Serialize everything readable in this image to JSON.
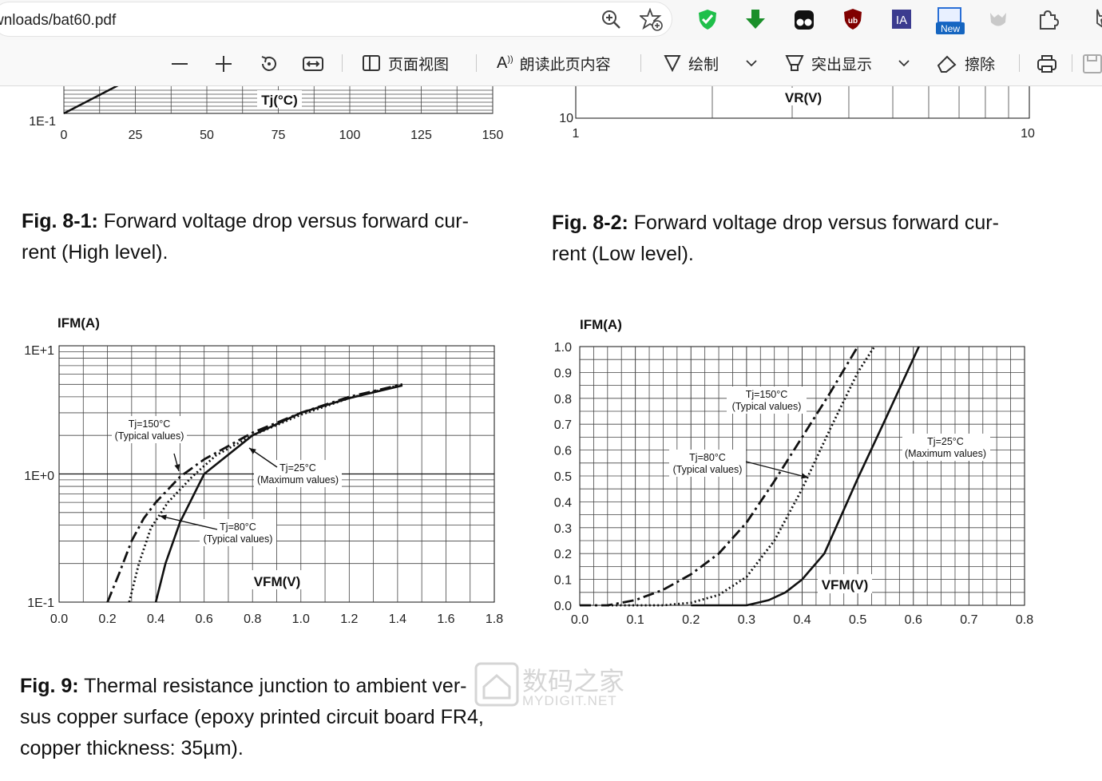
{
  "browser": {
    "url": "wnloads/bat60.pdf",
    "badge_new": "New",
    "ia_label": "IA",
    "ub_label": "ub"
  },
  "pdf_toolbar": {
    "page_view": "页面视图",
    "read_aloud": "朗读此页内容",
    "draw": "绘制",
    "highlight": "突出显示",
    "erase": "擦除",
    "read_prefix": "A"
  },
  "captions": {
    "fig81": {
      "label": "Fig. 8-1:",
      "line1": " Forward voltage drop versus forward cur-",
      "line2": "rent (High level)."
    },
    "fig82": {
      "label": "Fig. 8-2:",
      "line1": " Forward voltage drop versus forward cur-",
      "line2": "rent (Low level)."
    },
    "fig9": {
      "label": "Fig. 9:",
      "line1": " Thermal resistance junction to ambient ver-",
      "line2": "sus copper surface (epoxy printed circuit board FR4,",
      "line3": "copper thickness: 35µm)."
    }
  },
  "watermark": {
    "title": "数码之家",
    "subtitle": "MYDIGIT.NET"
  },
  "chart_data": [
    {
      "type": "line",
      "name_on_chart": "top-left partial",
      "xlabel": "Tj(°C)",
      "x_ticks": [
        "0",
        "25",
        "50",
        "75",
        "100",
        "125",
        "150"
      ],
      "y_ticks": [
        "1E-1"
      ],
      "series": [
        {
          "x": [
            0,
            20
          ],
          "y_frac_visible": [
            0.0,
            1.0
          ]
        }
      ]
    },
    {
      "type": "line",
      "name_on_chart": "top-right partial",
      "xlabel": "VR(V)",
      "x_ticks": [
        "1",
        "10"
      ],
      "y_ticks": [
        "10"
      ],
      "xscale": "log"
    },
    {
      "type": "line",
      "title": "",
      "ylabel": "IFM(A)",
      "xlabel": "VFM(V)",
      "yscale": "log",
      "xlim": [
        0,
        1.8
      ],
      "ylim": [
        0.1,
        10
      ],
      "x_ticks": [
        "0.0",
        "0.2",
        "0.4",
        "0.6",
        "0.8",
        "1.0",
        "1.2",
        "1.4",
        "1.6",
        "1.8"
      ],
      "y_ticks": [
        "1E-1",
        "1E+0",
        "1E+1"
      ],
      "annotations": [
        {
          "l1": "Tj=150°C",
          "l2": "(Typical values)"
        },
        {
          "l1": "Tj=25°C",
          "l2": "(Maximum values)"
        },
        {
          "l1": "Tj=80°C",
          "l2": "(Typical values)"
        }
      ],
      "series": [
        {
          "style": "dashdot",
          "x": [
            0.2,
            0.25,
            0.3,
            0.35,
            0.4,
            0.5,
            0.6,
            0.8,
            1.0,
            1.2,
            1.42
          ],
          "y": [
            0.1,
            0.17,
            0.3,
            0.45,
            0.6,
            0.95,
            1.3,
            2.1,
            3.0,
            4.0,
            5.0
          ]
        },
        {
          "style": "dotted",
          "x": [
            0.29,
            0.33,
            0.38,
            0.45,
            0.55,
            0.65,
            0.8,
            1.0,
            1.2,
            1.42
          ],
          "y": [
            0.1,
            0.2,
            0.38,
            0.6,
            0.95,
            1.4,
            2.0,
            2.9,
            3.9,
            5.0
          ]
        },
        {
          "style": "solid",
          "x": [
            0.4,
            0.44,
            0.5,
            0.6,
            0.8,
            1.0,
            1.2,
            1.42
          ],
          "y": [
            0.1,
            0.2,
            0.42,
            1.0,
            2.0,
            3.0,
            3.9,
            4.9
          ]
        }
      ]
    },
    {
      "type": "line",
      "title": "",
      "ylabel": "IFM(A)",
      "xlabel": "VFM(V)",
      "xlim": [
        0,
        0.8
      ],
      "ylim": [
        0,
        1.0
      ],
      "x_ticks": [
        "0.0",
        "0.1",
        "0.2",
        "0.3",
        "0.4",
        "0.5",
        "0.6",
        "0.7",
        "0.8"
      ],
      "y_ticks": [
        "0.0",
        "0.1",
        "0.2",
        "0.3",
        "0.4",
        "0.5",
        "0.6",
        "0.7",
        "0.8",
        "0.9",
        "1.0"
      ],
      "annotations": [
        {
          "l1": "Tj=150°C",
          "l2": "(Typical values)"
        },
        {
          "l1": "Tj=25°C",
          "l2": "(Maximum values)"
        },
        {
          "l1": "Tj=80°C",
          "l2": "(Typical values)"
        }
      ],
      "series": [
        {
          "style": "dashdot",
          "x": [
            0.0,
            0.05,
            0.1,
            0.15,
            0.2,
            0.25,
            0.3,
            0.35,
            0.4,
            0.45,
            0.5
          ],
          "y": [
            0.0,
            0.0,
            0.02,
            0.06,
            0.12,
            0.2,
            0.32,
            0.48,
            0.65,
            0.82,
            1.0
          ]
        },
        {
          "style": "dotted",
          "x": [
            0.05,
            0.15,
            0.2,
            0.25,
            0.3,
            0.35,
            0.4,
            0.45,
            0.5,
            0.53
          ],
          "y": [
            0.0,
            0.0,
            0.01,
            0.04,
            0.11,
            0.25,
            0.45,
            0.68,
            0.9,
            1.0
          ]
        },
        {
          "style": "solid",
          "x": [
            0.2,
            0.3,
            0.34,
            0.37,
            0.4,
            0.44,
            0.5,
            0.55,
            0.61
          ],
          "y": [
            0.0,
            0.0,
            0.02,
            0.05,
            0.1,
            0.2,
            0.49,
            0.72,
            1.0
          ]
        }
      ]
    }
  ]
}
